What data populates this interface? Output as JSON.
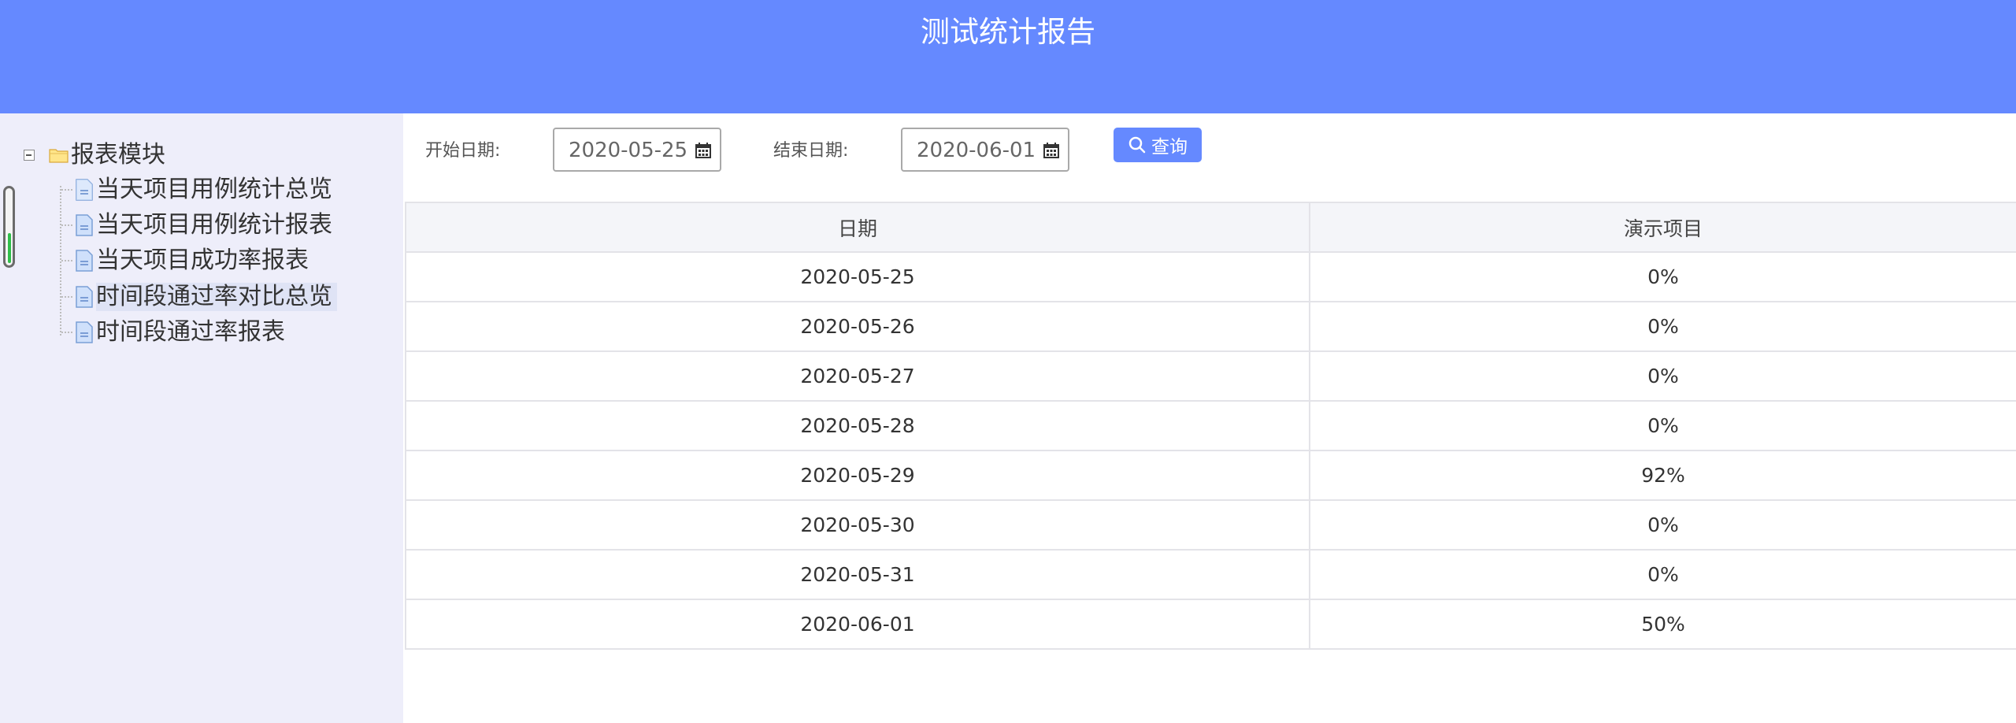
{
  "header": {
    "title": "测试统计报告"
  },
  "sidebar": {
    "root_label": "报表模块",
    "items": [
      {
        "label": "当天项目用例统计总览"
      },
      {
        "label": "当天项目用例统计报表"
      },
      {
        "label": "当天项目成功率报表"
      },
      {
        "label": "时间段通过率对比总览",
        "selected": true
      },
      {
        "label": "时间段通过率报表"
      }
    ]
  },
  "filters": {
    "start_label": "开始日期:",
    "start_value": "2020-05-25",
    "end_label": "结束日期:",
    "end_value": "2020-06-01",
    "query_label": "查询"
  },
  "table": {
    "headers": [
      "日期",
      "演示项目"
    ],
    "rows": [
      [
        "2020-05-25",
        "0%"
      ],
      [
        "2020-05-26",
        "0%"
      ],
      [
        "2020-05-27",
        "0%"
      ],
      [
        "2020-05-28",
        "0%"
      ],
      [
        "2020-05-29",
        "92%"
      ],
      [
        "2020-05-30",
        "0%"
      ],
      [
        "2020-05-31",
        "0%"
      ],
      [
        "2020-06-01",
        "50%"
      ]
    ]
  },
  "colors": {
    "accent": "#6589ff",
    "sidebar_bg": "#eeeefa",
    "table_header_bg": "#f4f5f9"
  },
  "icons": {
    "tree_toggle": "minus-box-icon",
    "root": "folder-icon",
    "item": "document-icon",
    "calendar": "calendar-icon",
    "search": "search-icon"
  }
}
